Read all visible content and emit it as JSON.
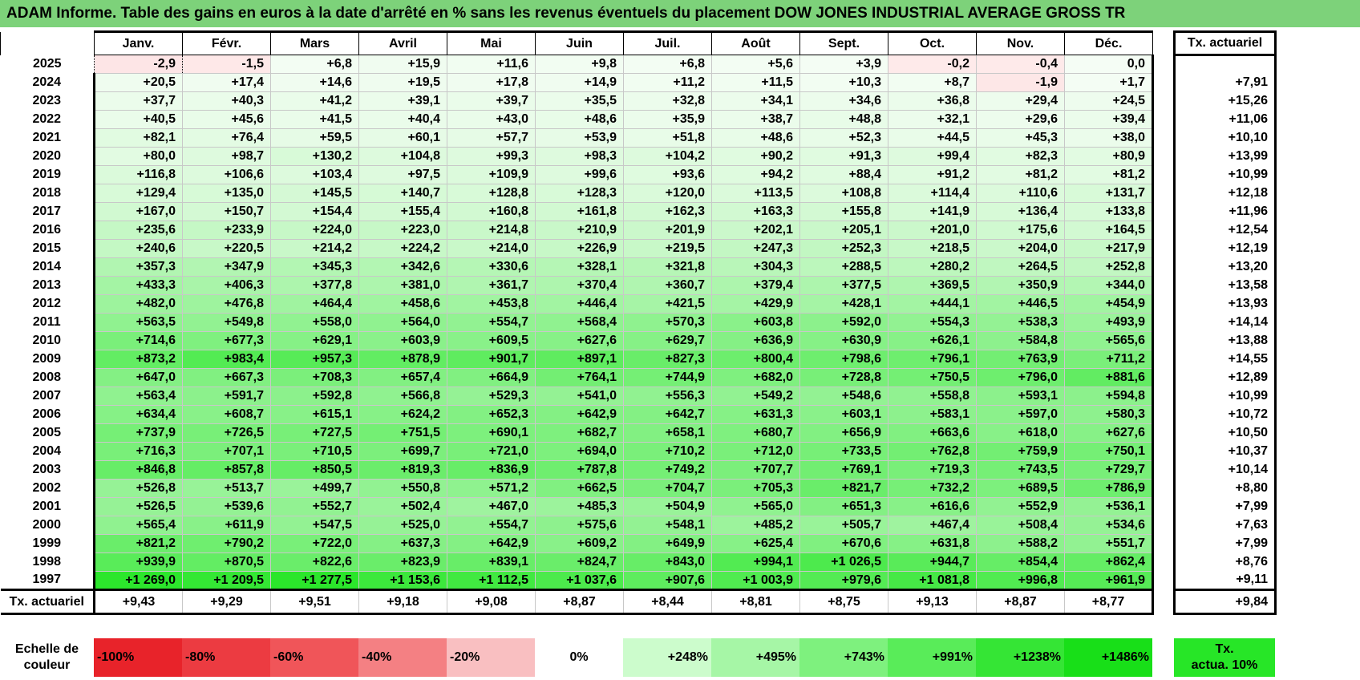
{
  "title": "ADAM Informe. Table des gains en euros à la date d'arrêté en % sans les revenus éventuels du placement DOW JONES INDUSTRIAL AVERAGE GROSS TR",
  "months": [
    "Janv.",
    "Févr.",
    "Mars",
    "Avril",
    "Mai",
    "Juin",
    "Juil.",
    "Août",
    "Sept.",
    "Oct.",
    "Nov.",
    "Déc."
  ],
  "tx_header": "Tx. actuariel",
  "rows": [
    {
      "year": "2025",
      "values": [
        "-2,9",
        "-1,5",
        "+6,8",
        "+15,9",
        "+11,6",
        "+9,8",
        "+6,8",
        "+5,6",
        "+3,9",
        "-0,2",
        "-0,4",
        "0,0"
      ],
      "tx": ""
    },
    {
      "year": "2024",
      "values": [
        "+20,5",
        "+17,4",
        "+14,6",
        "+19,5",
        "+17,8",
        "+14,9",
        "+11,2",
        "+11,5",
        "+10,3",
        "+8,7",
        "-1,9",
        "+1,7"
      ],
      "tx": "+7,91"
    },
    {
      "year": "2023",
      "values": [
        "+37,7",
        "+40,3",
        "+41,2",
        "+39,1",
        "+39,7",
        "+35,5",
        "+32,8",
        "+34,1",
        "+34,6",
        "+36,8",
        "+29,4",
        "+24,5"
      ],
      "tx": "+15,26"
    },
    {
      "year": "2022",
      "values": [
        "+40,5",
        "+45,6",
        "+41,5",
        "+40,4",
        "+43,0",
        "+48,6",
        "+35,9",
        "+38,7",
        "+48,8",
        "+32,1",
        "+29,6",
        "+39,4"
      ],
      "tx": "+11,06"
    },
    {
      "year": "2021",
      "values": [
        "+82,1",
        "+76,4",
        "+59,5",
        "+60,1",
        "+57,7",
        "+53,9",
        "+51,8",
        "+48,6",
        "+52,3",
        "+44,5",
        "+45,3",
        "+38,0"
      ],
      "tx": "+10,10"
    },
    {
      "year": "2020",
      "values": [
        "+80,0",
        "+98,7",
        "+130,2",
        "+104,8",
        "+99,3",
        "+98,3",
        "+104,2",
        "+90,2",
        "+91,3",
        "+99,4",
        "+82,3",
        "+80,9"
      ],
      "tx": "+13,99"
    },
    {
      "year": "2019",
      "values": [
        "+116,8",
        "+106,6",
        "+103,4",
        "+97,5",
        "+109,9",
        "+99,6",
        "+93,6",
        "+94,2",
        "+88,4",
        "+91,2",
        "+81,2",
        "+81,2"
      ],
      "tx": "+10,99"
    },
    {
      "year": "2018",
      "values": [
        "+129,4",
        "+135,0",
        "+145,5",
        "+140,7",
        "+128,8",
        "+128,3",
        "+120,0",
        "+113,5",
        "+108,8",
        "+114,4",
        "+110,6",
        "+131,7"
      ],
      "tx": "+12,18"
    },
    {
      "year": "2017",
      "values": [
        "+167,0",
        "+150,7",
        "+154,4",
        "+155,4",
        "+160,8",
        "+161,8",
        "+162,3",
        "+163,3",
        "+155,8",
        "+141,9",
        "+136,4",
        "+133,8"
      ],
      "tx": "+11,96"
    },
    {
      "year": "2016",
      "values": [
        "+235,6",
        "+233,9",
        "+224,0",
        "+223,0",
        "+214,8",
        "+210,9",
        "+201,9",
        "+202,1",
        "+205,1",
        "+201,0",
        "+175,6",
        "+164,5"
      ],
      "tx": "+12,54"
    },
    {
      "year": "2015",
      "values": [
        "+240,6",
        "+220,5",
        "+214,2",
        "+224,2",
        "+214,0",
        "+226,9",
        "+219,5",
        "+247,3",
        "+252,3",
        "+218,5",
        "+204,0",
        "+217,9"
      ],
      "tx": "+12,19"
    },
    {
      "year": "2014",
      "values": [
        "+357,3",
        "+347,9",
        "+345,3",
        "+342,6",
        "+330,6",
        "+328,1",
        "+321,8",
        "+304,3",
        "+288,5",
        "+280,2",
        "+264,5",
        "+252,8"
      ],
      "tx": "+13,20"
    },
    {
      "year": "2013",
      "values": [
        "+433,3",
        "+406,3",
        "+377,8",
        "+381,0",
        "+361,7",
        "+370,4",
        "+360,7",
        "+379,4",
        "+377,5",
        "+369,5",
        "+350,9",
        "+344,0"
      ],
      "tx": "+13,58"
    },
    {
      "year": "2012",
      "values": [
        "+482,0",
        "+476,8",
        "+464,4",
        "+458,6",
        "+453,8",
        "+446,4",
        "+421,5",
        "+429,9",
        "+428,1",
        "+444,1",
        "+446,5",
        "+454,9"
      ],
      "tx": "+13,93"
    },
    {
      "year": "2011",
      "values": [
        "+563,5",
        "+549,8",
        "+558,0",
        "+564,0",
        "+554,7",
        "+568,4",
        "+570,3",
        "+603,8",
        "+592,0",
        "+554,3",
        "+538,3",
        "+493,9"
      ],
      "tx": "+14,14"
    },
    {
      "year": "2010",
      "values": [
        "+714,6",
        "+677,3",
        "+629,1",
        "+603,9",
        "+609,5",
        "+627,6",
        "+629,7",
        "+636,9",
        "+630,9",
        "+626,1",
        "+584,8",
        "+565,6"
      ],
      "tx": "+13,88"
    },
    {
      "year": "2009",
      "values": [
        "+873,2",
        "+983,4",
        "+957,3",
        "+878,9",
        "+901,7",
        "+897,1",
        "+827,3",
        "+800,4",
        "+798,6",
        "+796,1",
        "+763,9",
        "+711,2"
      ],
      "tx": "+14,55"
    },
    {
      "year": "2008",
      "values": [
        "+647,0",
        "+667,3",
        "+708,3",
        "+657,4",
        "+664,9",
        "+764,1",
        "+744,9",
        "+682,0",
        "+728,8",
        "+750,5",
        "+796,0",
        "+881,6"
      ],
      "tx": "+12,89"
    },
    {
      "year": "2007",
      "values": [
        "+563,4",
        "+591,7",
        "+592,8",
        "+566,8",
        "+529,3",
        "+541,0",
        "+556,3",
        "+549,2",
        "+548,6",
        "+558,8",
        "+593,1",
        "+594,8"
      ],
      "tx": "+10,99"
    },
    {
      "year": "2006",
      "values": [
        "+634,4",
        "+608,7",
        "+615,1",
        "+624,2",
        "+652,3",
        "+642,9",
        "+642,7",
        "+631,3",
        "+603,1",
        "+583,1",
        "+597,0",
        "+580,3"
      ],
      "tx": "+10,72"
    },
    {
      "year": "2005",
      "values": [
        "+737,9",
        "+726,5",
        "+727,5",
        "+751,5",
        "+690,1",
        "+682,7",
        "+658,1",
        "+680,7",
        "+656,9",
        "+663,6",
        "+618,0",
        "+627,6"
      ],
      "tx": "+10,50"
    },
    {
      "year": "2004",
      "values": [
        "+716,3",
        "+707,1",
        "+710,5",
        "+699,7",
        "+721,0",
        "+694,0",
        "+710,2",
        "+712,0",
        "+733,5",
        "+762,8",
        "+759,9",
        "+750,1"
      ],
      "tx": "+10,37"
    },
    {
      "year": "2003",
      "values": [
        "+846,8",
        "+857,8",
        "+850,5",
        "+819,3",
        "+836,9",
        "+787,8",
        "+749,2",
        "+707,7",
        "+769,1",
        "+719,3",
        "+743,5",
        "+729,7"
      ],
      "tx": "+10,14"
    },
    {
      "year": "2002",
      "values": [
        "+526,8",
        "+513,7",
        "+499,7",
        "+550,8",
        "+571,2",
        "+662,5",
        "+704,7",
        "+705,3",
        "+821,7",
        "+732,2",
        "+689,5",
        "+786,9"
      ],
      "tx": "+8,80"
    },
    {
      "year": "2001",
      "values": [
        "+526,5",
        "+539,6",
        "+552,7",
        "+502,4",
        "+467,0",
        "+485,3",
        "+504,9",
        "+565,0",
        "+651,3",
        "+616,6",
        "+552,9",
        "+536,1"
      ],
      "tx": "+7,99"
    },
    {
      "year": "2000",
      "values": [
        "+565,4",
        "+611,9",
        "+547,5",
        "+525,0",
        "+554,7",
        "+575,6",
        "+548,1",
        "+485,2",
        "+505,7",
        "+467,4",
        "+508,4",
        "+534,6"
      ],
      "tx": "+7,63"
    },
    {
      "year": "1999",
      "values": [
        "+821,2",
        "+790,2",
        "+722,0",
        "+637,3",
        "+642,9",
        "+609,2",
        "+649,9",
        "+625,4",
        "+670,6",
        "+631,8",
        "+588,2",
        "+551,7"
      ],
      "tx": "+7,99"
    },
    {
      "year": "1998",
      "values": [
        "+939,9",
        "+870,5",
        "+822,6",
        "+823,9",
        "+839,1",
        "+824,7",
        "+843,0",
        "+994,1",
        "+1 026,5",
        "+944,7",
        "+854,4",
        "+862,4"
      ],
      "tx": "+8,76"
    },
    {
      "year": "1997",
      "values": [
        "+1 269,0",
        "+1 209,5",
        "+1 277,5",
        "+1 153,6",
        "+1 112,5",
        "+1 037,6",
        "+907,6",
        "+1 003,9",
        "+979,6",
        "+1 081,8",
        "+996,8",
        "+961,9"
      ],
      "tx": "+9,11"
    }
  ],
  "annual_row": {
    "label": "Tx. actuariel",
    "values": [
      "+9,43",
      "+9,29",
      "+9,51",
      "+9,18",
      "+9,08",
      "+8,87",
      "+8,44",
      "+8,81",
      "+8,75",
      "+9,13",
      "+8,87",
      "+8,77"
    ],
    "tx": "+9,84"
  },
  "scale": {
    "label_line1": "Echelle de",
    "label_line2": "couleur",
    "steps": [
      {
        "text": "-100%",
        "color": "#e8232a"
      },
      {
        "text": "-80%",
        "color": "#ec3b41"
      },
      {
        "text": "-60%",
        "color": "#f05559"
      },
      {
        "text": "-40%",
        "color": "#f48083"
      },
      {
        "text": "-20%",
        "color": "#f9bfc1"
      },
      {
        "text": "0%",
        "color": "#ffffff"
      },
      {
        "text": "+248%",
        "color": "#ccfccc"
      },
      {
        "text": "+495%",
        "color": "#a6f6a6"
      },
      {
        "text": "+743%",
        "color": "#7ef17e"
      },
      {
        "text": "+991%",
        "color": "#59ec59"
      },
      {
        "text": "+1238%",
        "color": "#35e535"
      },
      {
        "text": "+1486%",
        "color": "#18df18"
      }
    ],
    "legend_line1": "Tx.",
    "legend_line2": "actua. 10%"
  }
}
